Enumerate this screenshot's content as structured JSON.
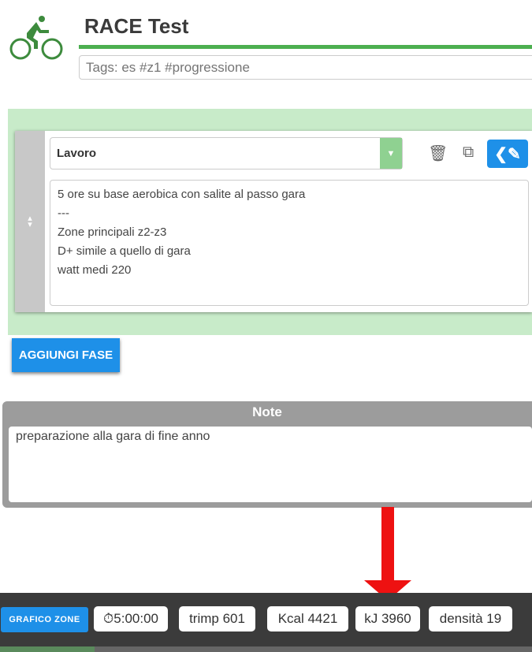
{
  "header": {
    "title": "RACE Test",
    "tags_placeholder": "Tags: es #z1 #progressione",
    "colors": {
      "accent": "#4caf50",
      "primary": "#1e90e8"
    }
  },
  "phase": {
    "type": "Lavoro",
    "description": "5 ore su base aerobica con salite al passo gara\n---\nZone principali z2-z3\nD+ simile a quello di gara\nwatt medi 220"
  },
  "add_phase_label": "AGGIUNGI FASE",
  "notes": {
    "heading": "Note",
    "text": "preparazione alla gara di fine anno"
  },
  "footer": {
    "zones_button": "GRAFICO ZONE",
    "duration": "5:00:00",
    "trimp": "trimp 601",
    "kcal": "Kcal 4421",
    "kj": "kJ 3960",
    "density": "densità 19"
  }
}
